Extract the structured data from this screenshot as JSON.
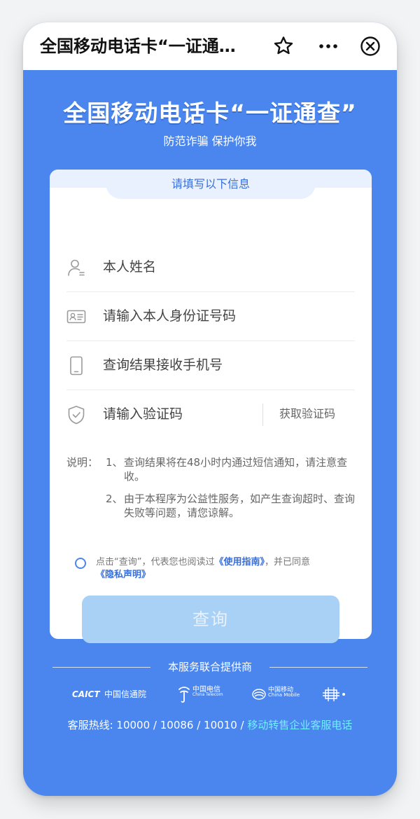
{
  "titlebar": {
    "title": "全国移动电话卡“一证通查”",
    "star_icon": "star-icon",
    "more_icon": "more-icon",
    "close_icon": "close-icon"
  },
  "hero": {
    "title": "全国移动电话卡“一证通查”",
    "subtitle": "防范诈骗 保护你我"
  },
  "form": {
    "heading": "请填写以下信息",
    "name_placeholder": "本人姓名",
    "id_placeholder": "请输入本人身份证号码",
    "phone_placeholder": "查询结果接收手机号",
    "code_placeholder": "请输入验证码",
    "get_code_label": "获取验证码"
  },
  "notes": {
    "label": "说明：",
    "items": [
      {
        "num": "1、",
        "text": "查询结果将在48小时内通过短信通知，请注意查收。"
      },
      {
        "num": "2、",
        "text": "由于本程序为公益性服务，如产生查询超时、查询失败等问题，请您谅解。"
      }
    ]
  },
  "agreement": {
    "prefix": "点击“查询”，代表您也阅读过",
    "guide_link": "《使用指南》",
    "middle": "，并已同意",
    "privacy_link": "《隐私声明》"
  },
  "query_button": "查询",
  "providers": {
    "title": "本服务联合提供商",
    "caict_brand": "CAICT",
    "caict_name": "中国信通院",
    "telecom_name": "中国电信",
    "telecom_en": "China Telecom",
    "mobile_name": "中国移动",
    "mobile_en": "China Mobile"
  },
  "hotline": {
    "label": "客服热线: 10000 / 10086 / 10010 / ",
    "link": "移动转售企业客服电话"
  },
  "colors": {
    "primary_blue": "#4a86ee",
    "link_blue": "#3a6fd8",
    "button_disabled": "#a9d1f6",
    "hotline_link": "#6ff0ff"
  }
}
